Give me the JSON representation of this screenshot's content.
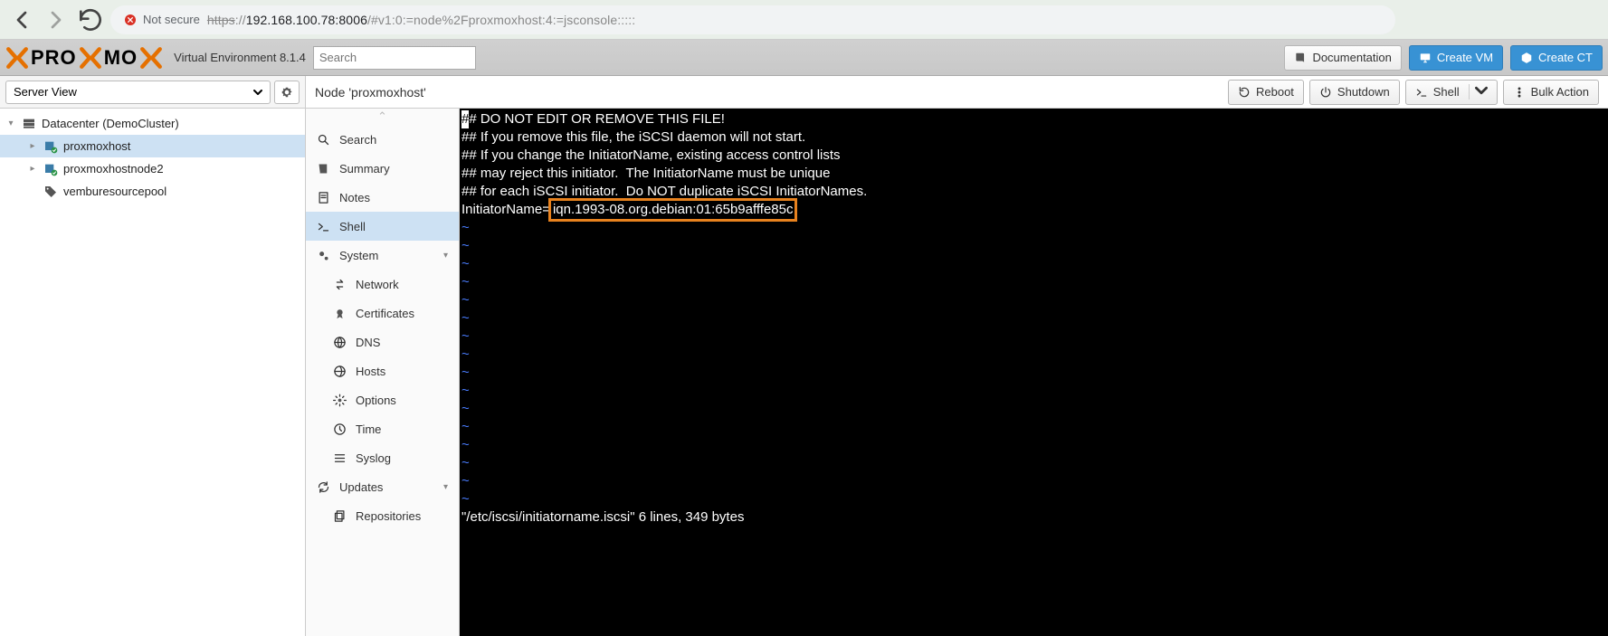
{
  "browser": {
    "not_secure": "Not secure",
    "url_https": "https",
    "url_sep": "://",
    "url_host": "192.168.100.78:8006",
    "url_path": "/#v1:0:=node%2Fproxmoxhost:4:=jsconsole:::::"
  },
  "header": {
    "logo_text_1": "PRO",
    "logo_text_2": "MO",
    "version": "Virtual Environment 8.1.4",
    "search_placeholder": "Search",
    "doc": "Documentation",
    "create_vm": "Create VM",
    "create_ct": "Create CT"
  },
  "view_selector": "Server View",
  "tree": {
    "datacenter": "Datacenter (DemoCluster)",
    "node1": "proxmoxhost",
    "node2": "proxmoxhostnode2",
    "pool": "vemburesourcepool"
  },
  "node": {
    "title": "Node 'proxmoxhost'",
    "reboot": "Reboot",
    "shutdown": "Shutdown",
    "shell": "Shell",
    "bulk": "Bulk Action"
  },
  "menu": {
    "search": "Search",
    "summary": "Summary",
    "notes": "Notes",
    "shell": "Shell",
    "system": "System",
    "network": "Network",
    "certificates": "Certificates",
    "dns": "DNS",
    "hosts": "Hosts",
    "options": "Options",
    "time": "Time",
    "syslog": "Syslog",
    "updates": "Updates",
    "repositories": "Repositories"
  },
  "console": {
    "l1": "# DO NOT EDIT OR REMOVE THIS FILE!",
    "l2": "## If you remove this file, the iSCSI daemon will not start.",
    "l3": "## If you change the InitiatorName, existing access control lists",
    "l4": "## may reject this initiator.  The InitiatorName must be unique",
    "l5": "## for each iSCSI initiator.  Do NOT duplicate iSCSI InitiatorNames.",
    "l6_pre": "InitiatorName=",
    "l6_iqn": "iqn.1993-08.org.debian:01:65b9afffe85c",
    "tilde": "~",
    "status": "\"/etc/iscsi/initiatorname.iscsi\" 6 lines, 349 bytes"
  }
}
